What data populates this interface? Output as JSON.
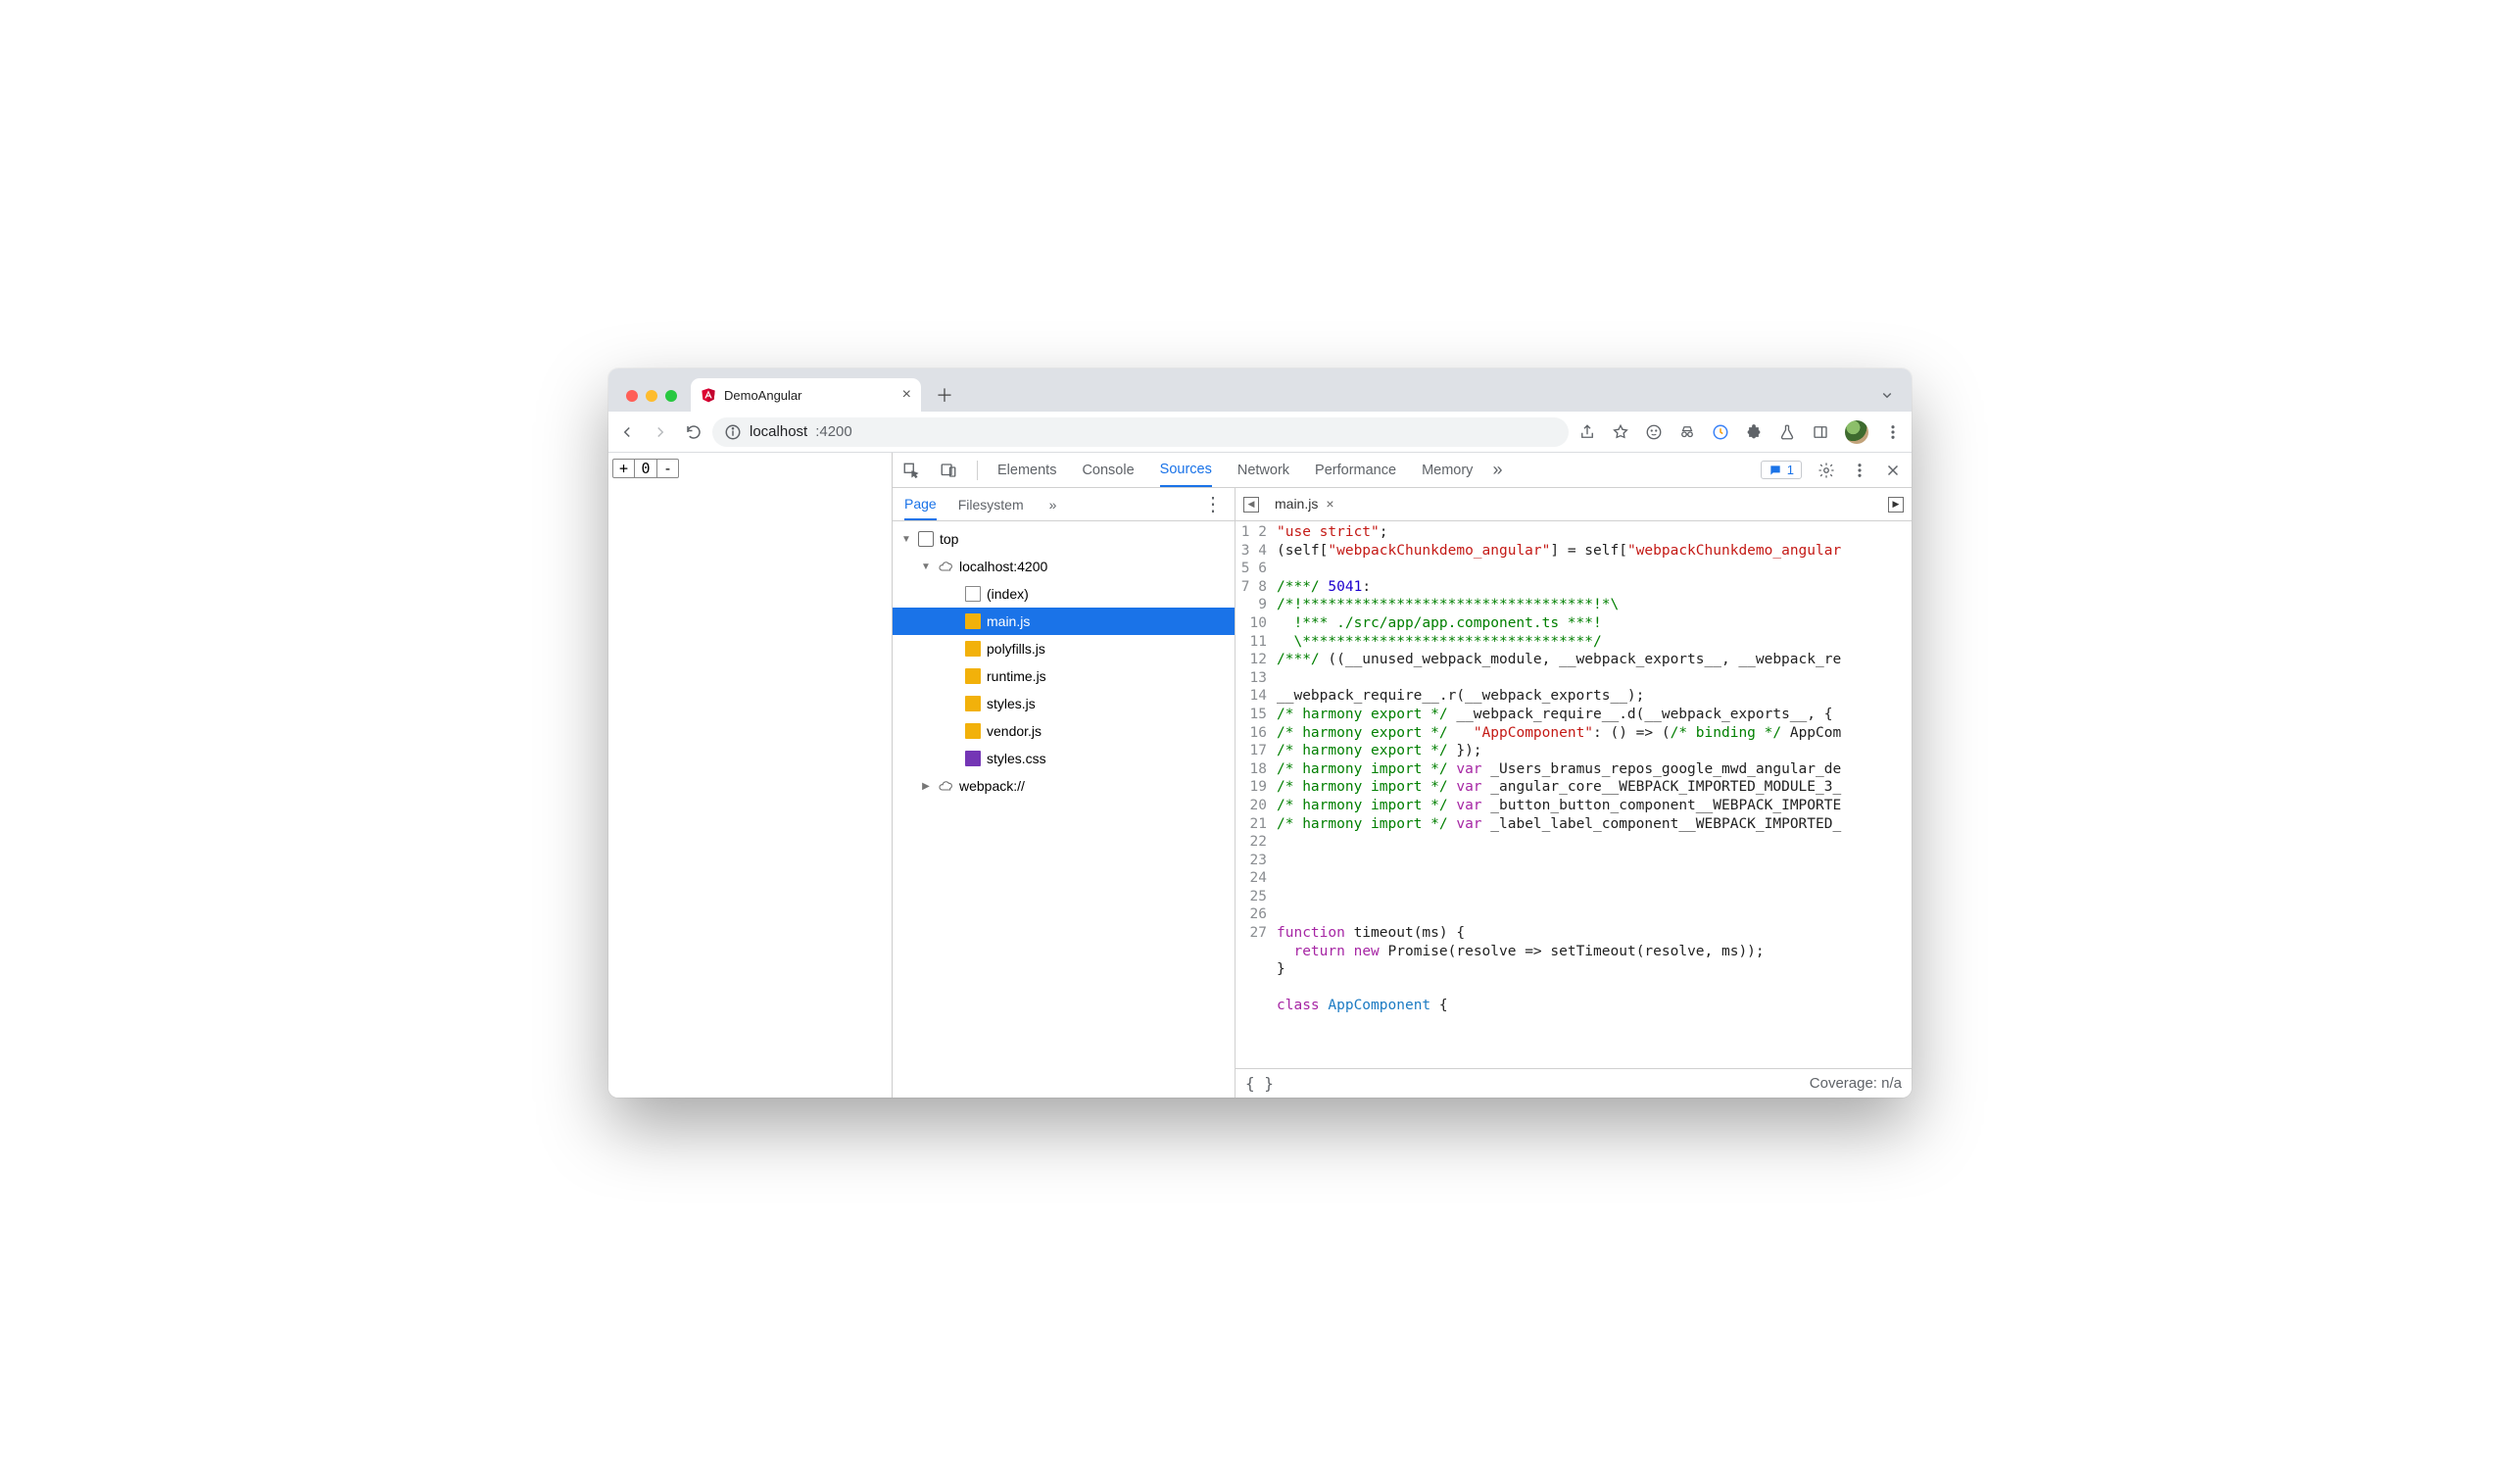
{
  "browser": {
    "tab_title": "DemoAngular",
    "url_host": "localhost",
    "url_port": ":4200",
    "page_widget": {
      "plus": "+",
      "value": "0",
      "minus": "-"
    }
  },
  "devtools": {
    "tabs": [
      "Elements",
      "Console",
      "Sources",
      "Network",
      "Performance",
      "Memory"
    ],
    "active_tab": "Sources",
    "issues_count": "1",
    "sources": {
      "left_tabs": [
        "Page",
        "Filesystem"
      ],
      "active_left_tab": "Page",
      "tree": [
        {
          "depth": 0,
          "label": "top",
          "icon": "frame",
          "twist": "▼"
        },
        {
          "depth": 1,
          "label": "localhost:4200",
          "icon": "cloud",
          "twist": "▼"
        },
        {
          "depth": 2,
          "label": "(index)",
          "icon": "page"
        },
        {
          "depth": 2,
          "label": "main.js",
          "icon": "js",
          "selected": true
        },
        {
          "depth": 2,
          "label": "polyfills.js",
          "icon": "js"
        },
        {
          "depth": 2,
          "label": "runtime.js",
          "icon": "js"
        },
        {
          "depth": 2,
          "label": "styles.js",
          "icon": "js"
        },
        {
          "depth": 2,
          "label": "vendor.js",
          "icon": "js"
        },
        {
          "depth": 2,
          "label": "styles.css",
          "icon": "css"
        },
        {
          "depth": 1,
          "label": "webpack://",
          "icon": "cloud",
          "twist": "▶"
        }
      ],
      "open_file": "main.js",
      "coverage": "Coverage: n/a",
      "code_lines": [
        [
          [
            "str",
            "\"use strict\""
          ],
          [
            "",
            ";"
          ]
        ],
        [
          [
            "",
            "(self["
          ],
          [
            "str",
            "\"webpackChunkdemo_angular\""
          ],
          [
            "",
            "] = self["
          ],
          [
            "str",
            "\"webpackChunkdemo_angular"
          ]
        ],
        [],
        [
          [
            "cm",
            "/***/ "
          ],
          [
            "num",
            "5041"
          ],
          [
            "",
            ":"
          ]
        ],
        [
          [
            "cm",
            "/*!**********************************!*\\"
          ]
        ],
        [
          [
            "cm",
            "  !*** ./src/app/app.component.ts ***!"
          ]
        ],
        [
          [
            "cm",
            "  \\**********************************/"
          ]
        ],
        [
          [
            "cm",
            "/***/"
          ],
          [
            "",
            " ((__unused_webpack_module, __webpack_exports__, __webpack_re"
          ]
        ],
        [],
        [
          [
            "",
            "__webpack_require__.r(__webpack_exports__);"
          ]
        ],
        [
          [
            "cm",
            "/* harmony export */"
          ],
          [
            "",
            " __webpack_require__.d(__webpack_exports__, {"
          ]
        ],
        [
          [
            "cm",
            "/* harmony export */"
          ],
          [
            "",
            "   "
          ],
          [
            "str",
            "\"AppComponent\""
          ],
          [
            "",
            ": () => ("
          ],
          [
            "cm",
            "/* binding */"
          ],
          [
            "",
            " AppCom"
          ]
        ],
        [
          [
            "cm",
            "/* harmony export */"
          ],
          [
            "",
            " });"
          ]
        ],
        [
          [
            "cm",
            "/* harmony import */"
          ],
          [
            "",
            " "
          ],
          [
            "kw",
            "var"
          ],
          [
            "",
            " _Users_bramus_repos_google_mwd_angular_de"
          ]
        ],
        [
          [
            "cm",
            "/* harmony import */"
          ],
          [
            "",
            " "
          ],
          [
            "kw",
            "var"
          ],
          [
            "",
            " _angular_core__WEBPACK_IMPORTED_MODULE_3_"
          ]
        ],
        [
          [
            "cm",
            "/* harmony import */"
          ],
          [
            "",
            " "
          ],
          [
            "kw",
            "var"
          ],
          [
            "",
            " _button_button_component__WEBPACK_IMPORTE"
          ]
        ],
        [
          [
            "cm",
            "/* harmony import */"
          ],
          [
            "",
            " "
          ],
          [
            "kw",
            "var"
          ],
          [
            "",
            " _label_label_component__WEBPACK_IMPORTED_"
          ]
        ],
        [],
        [],
        [],
        [],
        [],
        [
          [
            "kw",
            "function"
          ],
          [
            "",
            " "
          ],
          [
            "fn",
            "timeout"
          ],
          [
            "",
            "(ms) {"
          ]
        ],
        [
          [
            "",
            "  "
          ],
          [
            "kw",
            "return"
          ],
          [
            "",
            " "
          ],
          [
            "kw",
            "new"
          ],
          [
            "",
            " Promise(resolve => setTimeout(resolve, ms));"
          ]
        ],
        [
          [
            "",
            "}"
          ]
        ],
        [],
        [
          [
            "kw",
            "class"
          ],
          [
            "",
            " "
          ],
          [
            "id",
            "AppComponent"
          ],
          [
            "",
            " {"
          ]
        ]
      ]
    }
  }
}
